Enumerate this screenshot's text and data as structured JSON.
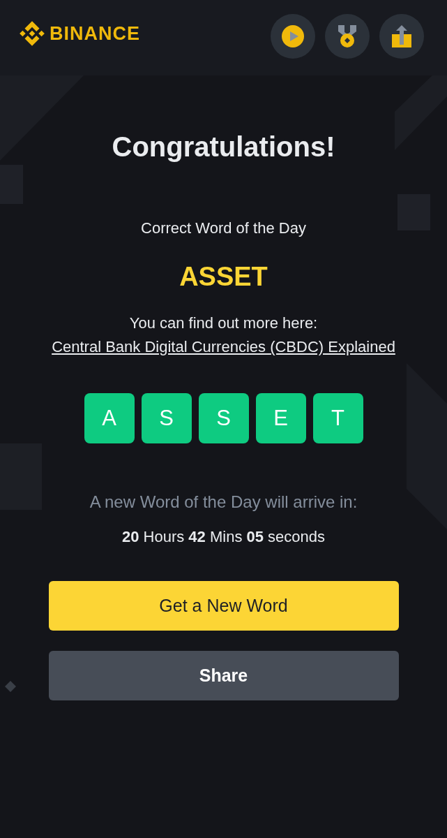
{
  "header": {
    "logo_text": "BINANCE",
    "buttons": [
      {
        "kind": "play"
      },
      {
        "kind": "medal"
      },
      {
        "kind": "upload"
      }
    ]
  },
  "content": {
    "title": "Congratulations!",
    "subtitle": "Correct Word of the Day",
    "word": "ASSET",
    "info_text": "You can find out more here:",
    "info_link": "Central Bank Digital Currencies (CBDC) Explained",
    "tiles": [
      {
        "letter": "A",
        "correct": true
      },
      {
        "letter": "S",
        "correct": true
      },
      {
        "letter": "S",
        "correct": true
      },
      {
        "letter": "E",
        "correct": true
      },
      {
        "letter": "T",
        "correct": true
      }
    ],
    "next_word_text": "A new Word of the Day will arrive in:",
    "countdown": "**20** Hours **42** Mins **05** seconds"
  },
  "actions": [
    {
      "label": "Get a New Word",
      "kind": "primary"
    },
    {
      "label": "Share",
      "kind": "secondary"
    }
  ]
}
